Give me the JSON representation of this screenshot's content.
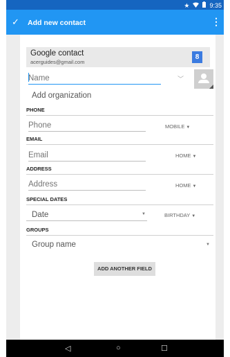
{
  "status_bar": {
    "time": "9:35",
    "icons": [
      "star-icon",
      "wifi-icon",
      "battery-icon"
    ]
  },
  "app_bar": {
    "title": "Add new contact",
    "confirm_icon": "check-icon",
    "menu_icon": "overflow-menu-icon"
  },
  "account": {
    "type": "Google contact",
    "email": "acerguides@gmail.com",
    "badge": "8"
  },
  "name": {
    "placeholder": "Name"
  },
  "organization": {
    "label": "Add organization"
  },
  "sections": {
    "phone": {
      "header": "PHONE",
      "placeholder": "Phone",
      "type": "MOBILE"
    },
    "email": {
      "header": "EMAIL",
      "placeholder": "Email",
      "type": "HOME"
    },
    "address": {
      "header": "ADDRESS",
      "placeholder": "Address",
      "type": "HOME"
    },
    "special_dates": {
      "header": "SPECIAL DATES",
      "placeholder": "Date",
      "type": "BIRTHDAY"
    },
    "groups": {
      "header": "GROUPS",
      "placeholder": "Group name"
    }
  },
  "actions": {
    "add_field": "ADD ANOTHER FIELD"
  },
  "nav": {
    "back": "◁",
    "home": "○",
    "recent": "☐"
  }
}
